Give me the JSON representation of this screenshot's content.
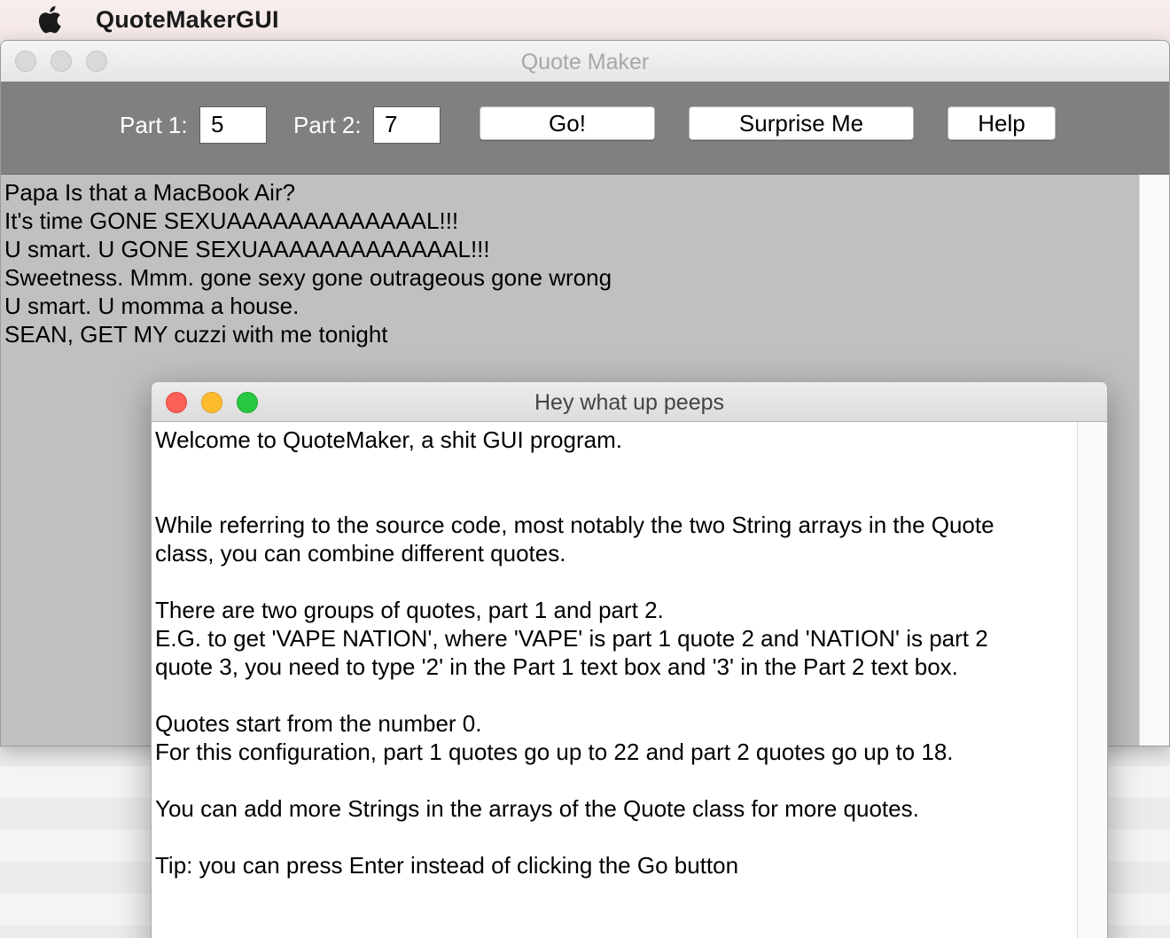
{
  "menubar": {
    "app_name": "QuoteMakerGUI",
    "apple_icon": "apple-logo-icon"
  },
  "main_window": {
    "title": "Quote Maker",
    "toolbar": {
      "part1_label": "Part 1:",
      "part1_value": "5",
      "part2_label": "Part 2:",
      "part2_value": "7",
      "go_label": "Go!",
      "surprise_label": "Surprise Me",
      "help_label": "Help"
    },
    "output_lines": [
      "Papa Is that a MacBook Air?",
      "It's time GONE SEXUAAAAAAAAAAAAAL!!!",
      "U smart. U GONE SEXUAAAAAAAAAAAAAL!!!",
      "Sweetness. Mmm. gone sexy gone outrageous gone wrong",
      "U smart. U momma a house.",
      "SEAN, GET MY cuzzi with me tonight"
    ]
  },
  "dialog": {
    "title": "Hey what up peeps",
    "lines": [
      "Welcome to QuoteMaker, a shit GUI program.",
      "",
      "",
      "While referring to the source code, most notably the two String arrays in the Quote",
      "class, you can combine different quotes.",
      "",
      "There are two groups of quotes, part 1 and part 2.",
      "E.G. to get 'VAPE NATION', where 'VAPE' is part 1 quote 2 and 'NATION' is part 2",
      "quote 3, you need to type '2' in the Part 1 text box and '3' in the Part 2 text box.",
      "",
      "Quotes start from the number 0.",
      "For this configuration, part 1 quotes go up to 22 and part 2 quotes go up to 18.",
      "",
      "You can add more Strings in the arrays of the Quote class for more quotes.",
      "",
      "Tip: you can press Enter instead of clicking the Go button"
    ]
  },
  "colors": {
    "toolbar_bg": "#808080",
    "output_bg": "#c0c0c0",
    "close_button": "#fc5f57",
    "minimize_button": "#fdbc2e",
    "zoom_button": "#28c840"
  }
}
